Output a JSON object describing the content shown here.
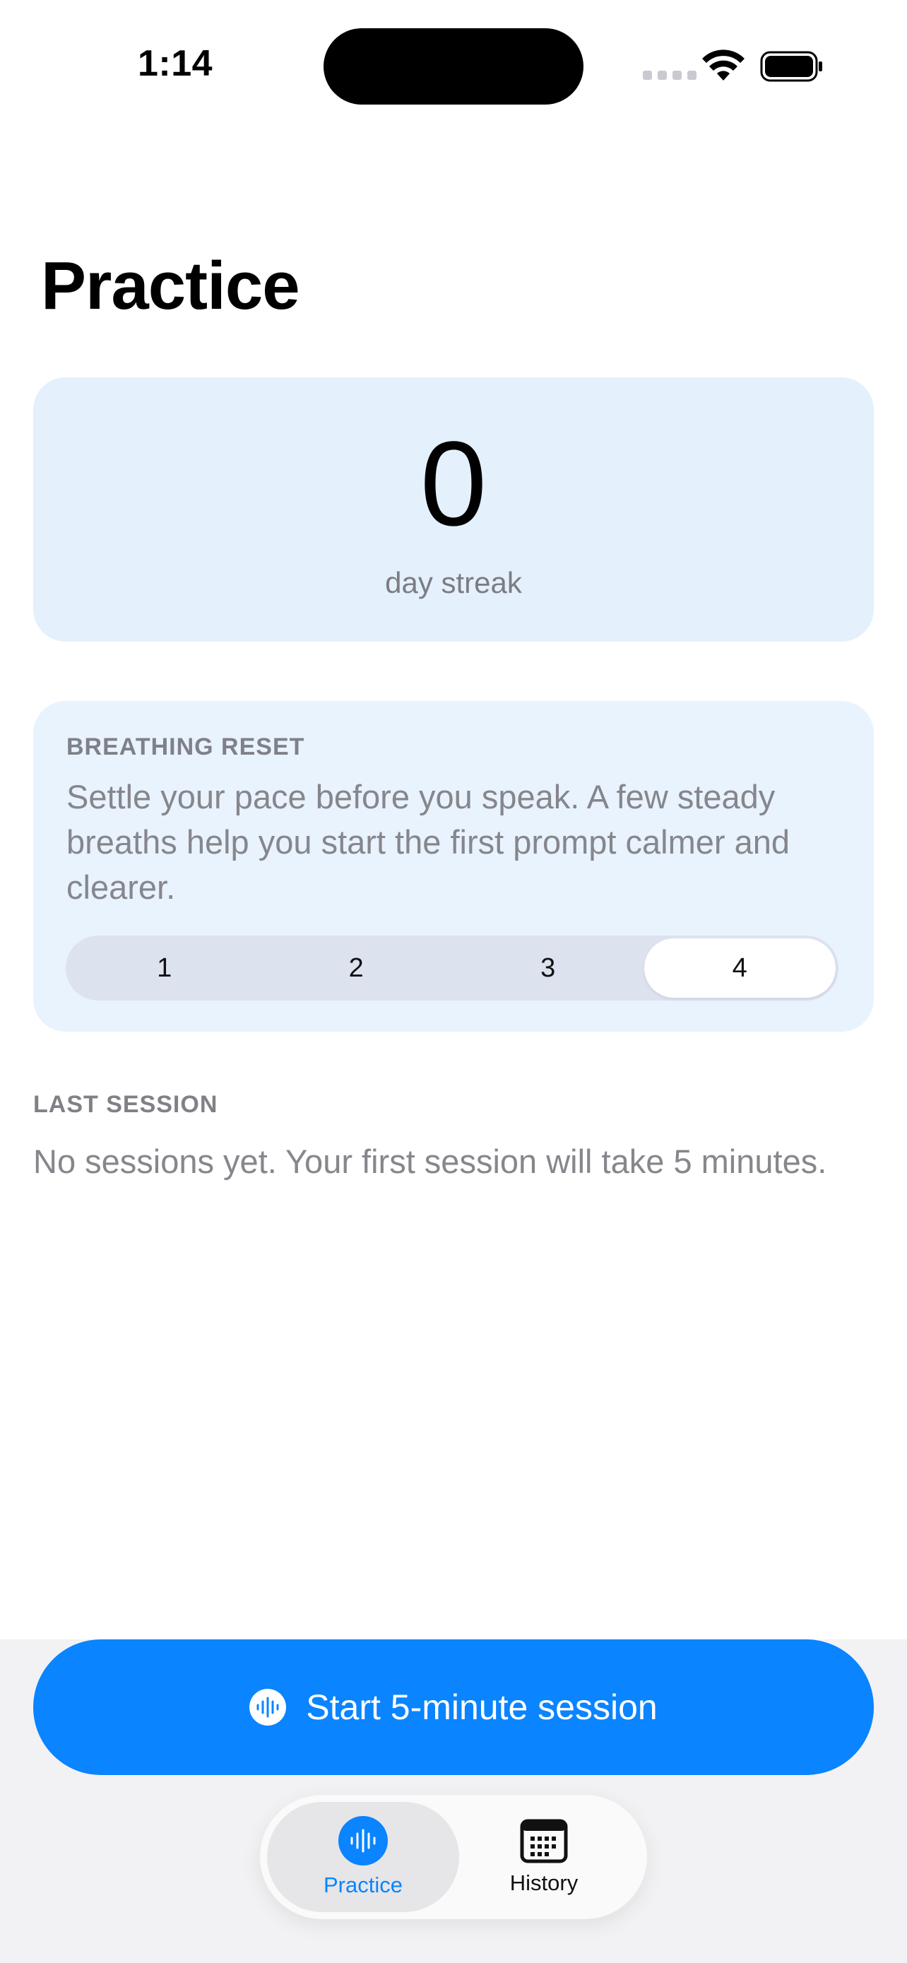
{
  "status_bar": {
    "time": "1:14"
  },
  "page": {
    "title": "Practice"
  },
  "streak": {
    "count": "0",
    "label": "day streak"
  },
  "breathing": {
    "heading": "BREATHING RESET",
    "description": "Settle your pace before you speak. A few steady breaths help you start the first prompt calmer and clearer.",
    "options": [
      "1",
      "2",
      "3",
      "4"
    ],
    "selected": "4"
  },
  "last_session": {
    "heading": "LAST SESSION",
    "text": "No sessions yet. Your first session will take 5 minutes."
  },
  "cta": {
    "label": "Start 5-minute session",
    "icon": "waveform-icon"
  },
  "tabs": [
    {
      "label": "Practice",
      "icon": "waveform-icon",
      "active": true
    },
    {
      "label": "History",
      "icon": "calendar-icon",
      "active": false
    }
  ],
  "colors": {
    "accent": "#0a84ff",
    "card_bg": "#e4f0fc",
    "secondary_text": "#86868c"
  }
}
